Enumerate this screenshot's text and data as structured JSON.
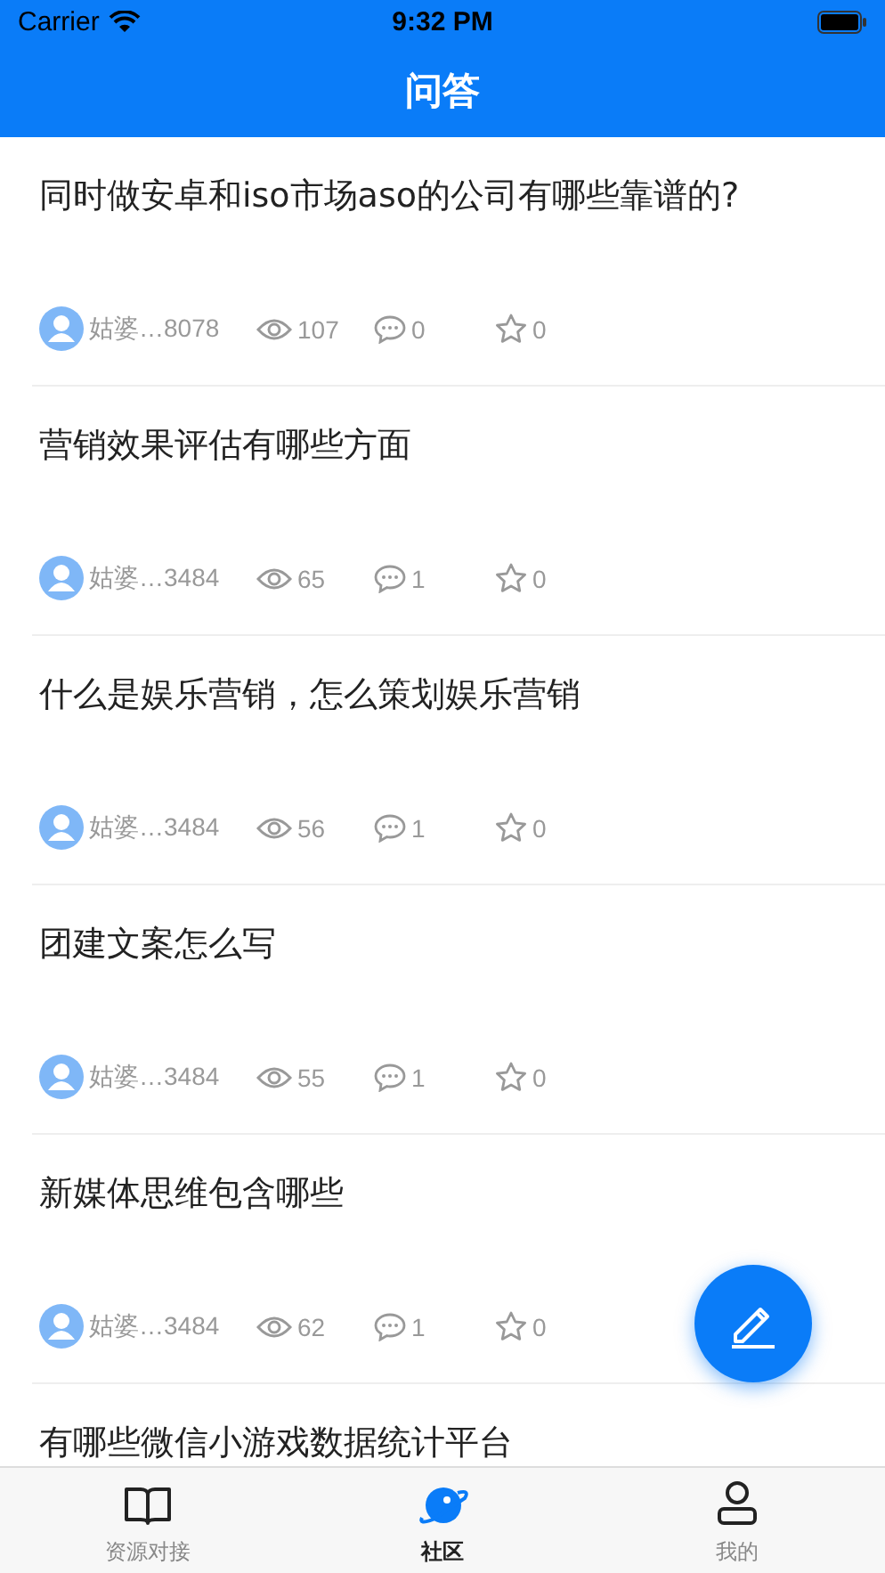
{
  "status_bar": {
    "carrier": "Carrier",
    "time": "9:32 PM"
  },
  "nav": {
    "title": "问答"
  },
  "questions": [
    {
      "title": "同时做安卓和iso市场aso的公司有哪些靠谱的?",
      "author": "姑婆…8078",
      "views": "107",
      "comments": "0",
      "favorites": "0"
    },
    {
      "title": "营销效果评估有哪些方面",
      "author": "姑婆…3484",
      "views": "65",
      "comments": "1",
      "favorites": "0"
    },
    {
      "title": "什么是娱乐营销，怎么策划娱乐营销",
      "author": "姑婆…3484",
      "views": "56",
      "comments": "1",
      "favorites": "0"
    },
    {
      "title": "团建文案怎么写",
      "author": "姑婆…3484",
      "views": "55",
      "comments": "1",
      "favorites": "0"
    },
    {
      "title": "新媒体思维包含哪些",
      "author": "姑婆…3484",
      "views": "62",
      "comments": "1",
      "favorites": "0"
    },
    {
      "title": "有哪些微信小游戏数据统计平台"
    }
  ],
  "tabs": [
    {
      "label": "资源对接",
      "kind": "book",
      "selected": false
    },
    {
      "label": "社区",
      "kind": "planet",
      "selected": true
    },
    {
      "label": "我的",
      "kind": "person",
      "selected": false
    }
  ]
}
